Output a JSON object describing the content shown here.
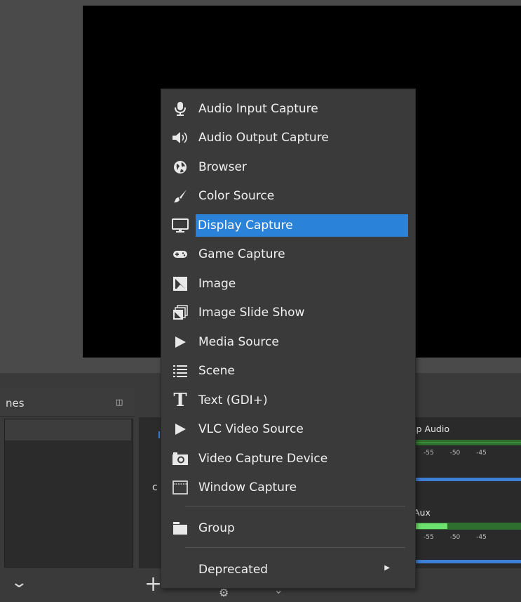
{
  "docks": {
    "scenes": {
      "title_fragment": "nes"
    },
    "sources": {
      "row_fragment": "c"
    },
    "mixer": {
      "channels": [
        {
          "label_fragment": "top Audio",
          "scale": [
            "-55",
            "-50",
            "-45"
          ]
        },
        {
          "label_fragment": "Aux",
          "scale": [
            "-55",
            "-50",
            "-45"
          ]
        }
      ]
    }
  },
  "menu": {
    "items": [
      {
        "label": "Audio Input Capture",
        "icon": "microphone-icon"
      },
      {
        "label": "Audio Output Capture",
        "icon": "speaker-icon"
      },
      {
        "label": "Browser",
        "icon": "globe-icon"
      },
      {
        "label": "Color Source",
        "icon": "paintbrush-icon"
      },
      {
        "label": "Display Capture",
        "icon": "monitor-icon",
        "selected": true
      },
      {
        "label": "Game Capture",
        "icon": "gamepad-icon"
      },
      {
        "label": "Image",
        "icon": "image-icon"
      },
      {
        "label": "Image Slide Show",
        "icon": "slideshow-icon"
      },
      {
        "label": "Media Source",
        "icon": "play-icon"
      },
      {
        "label": "Scene",
        "icon": "list-icon"
      },
      {
        "label": "Text (GDI+)",
        "icon": "text-icon"
      },
      {
        "label": "VLC Video Source",
        "icon": "play-icon"
      },
      {
        "label": "Video Capture Device",
        "icon": "camera-icon"
      },
      {
        "label": "Window Capture",
        "icon": "window-icon"
      }
    ],
    "group": {
      "label": "Group",
      "icon": "folder-icon"
    },
    "deprecated": {
      "label": "Deprecated",
      "icon": "submenu-arrow-icon"
    }
  },
  "colors": {
    "selection": "#2b82d9",
    "menu_bg": "#3a3a3a",
    "meter_green": "#2e6e2e",
    "fader_blue": "#3d7fd6"
  }
}
